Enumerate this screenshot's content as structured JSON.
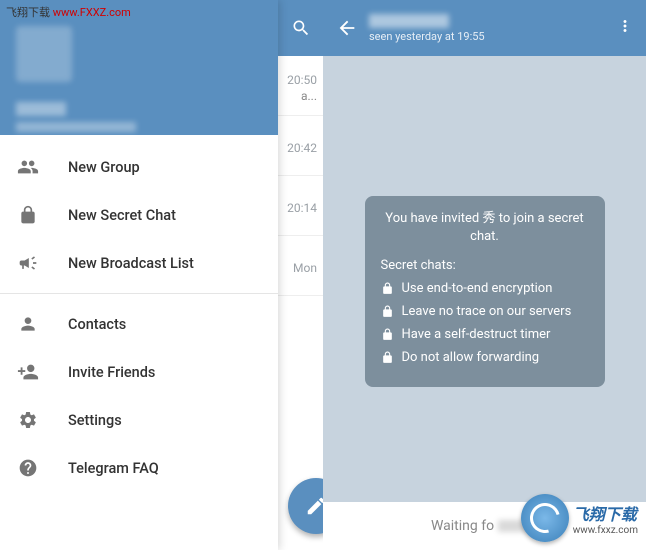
{
  "watermark": {
    "label": "飞翔下载",
    "url": "www.FXXZ.com"
  },
  "corner_logo": {
    "title": "飞翔下载",
    "url": "www.fxxz.com"
  },
  "drawer": {
    "menu": [
      {
        "label": "New Group",
        "icon": "group"
      },
      {
        "label": "New Secret Chat",
        "icon": "lock"
      },
      {
        "label": "New Broadcast List",
        "icon": "megaphone"
      }
    ],
    "menu2": [
      {
        "label": "Contacts",
        "icon": "person"
      },
      {
        "label": "Invite Friends",
        "icon": "person-add"
      },
      {
        "label": "Settings",
        "icon": "gear"
      },
      {
        "label": "Telegram FAQ",
        "icon": "help"
      }
    ]
  },
  "chat_list": {
    "rows": [
      {
        "time": "20:50",
        "preview": "a..."
      },
      {
        "time": "20:42",
        "preview": ""
      },
      {
        "time": "20:14",
        "preview": ""
      },
      {
        "time": "Mon",
        "preview": ""
      }
    ]
  },
  "secret_chat": {
    "header": {
      "last_seen": "seen yesterday at 19:55"
    },
    "info": {
      "invite_line": "You have invited 秀 to join a secret chat.",
      "subtitle": "Secret chats:",
      "features": [
        "Use end-to-end encryption",
        "Leave no trace on our servers",
        "Have a self-destruct timer",
        "Do not allow forwarding"
      ]
    },
    "input": {
      "waiting_prefix": "Waiting fo"
    }
  }
}
